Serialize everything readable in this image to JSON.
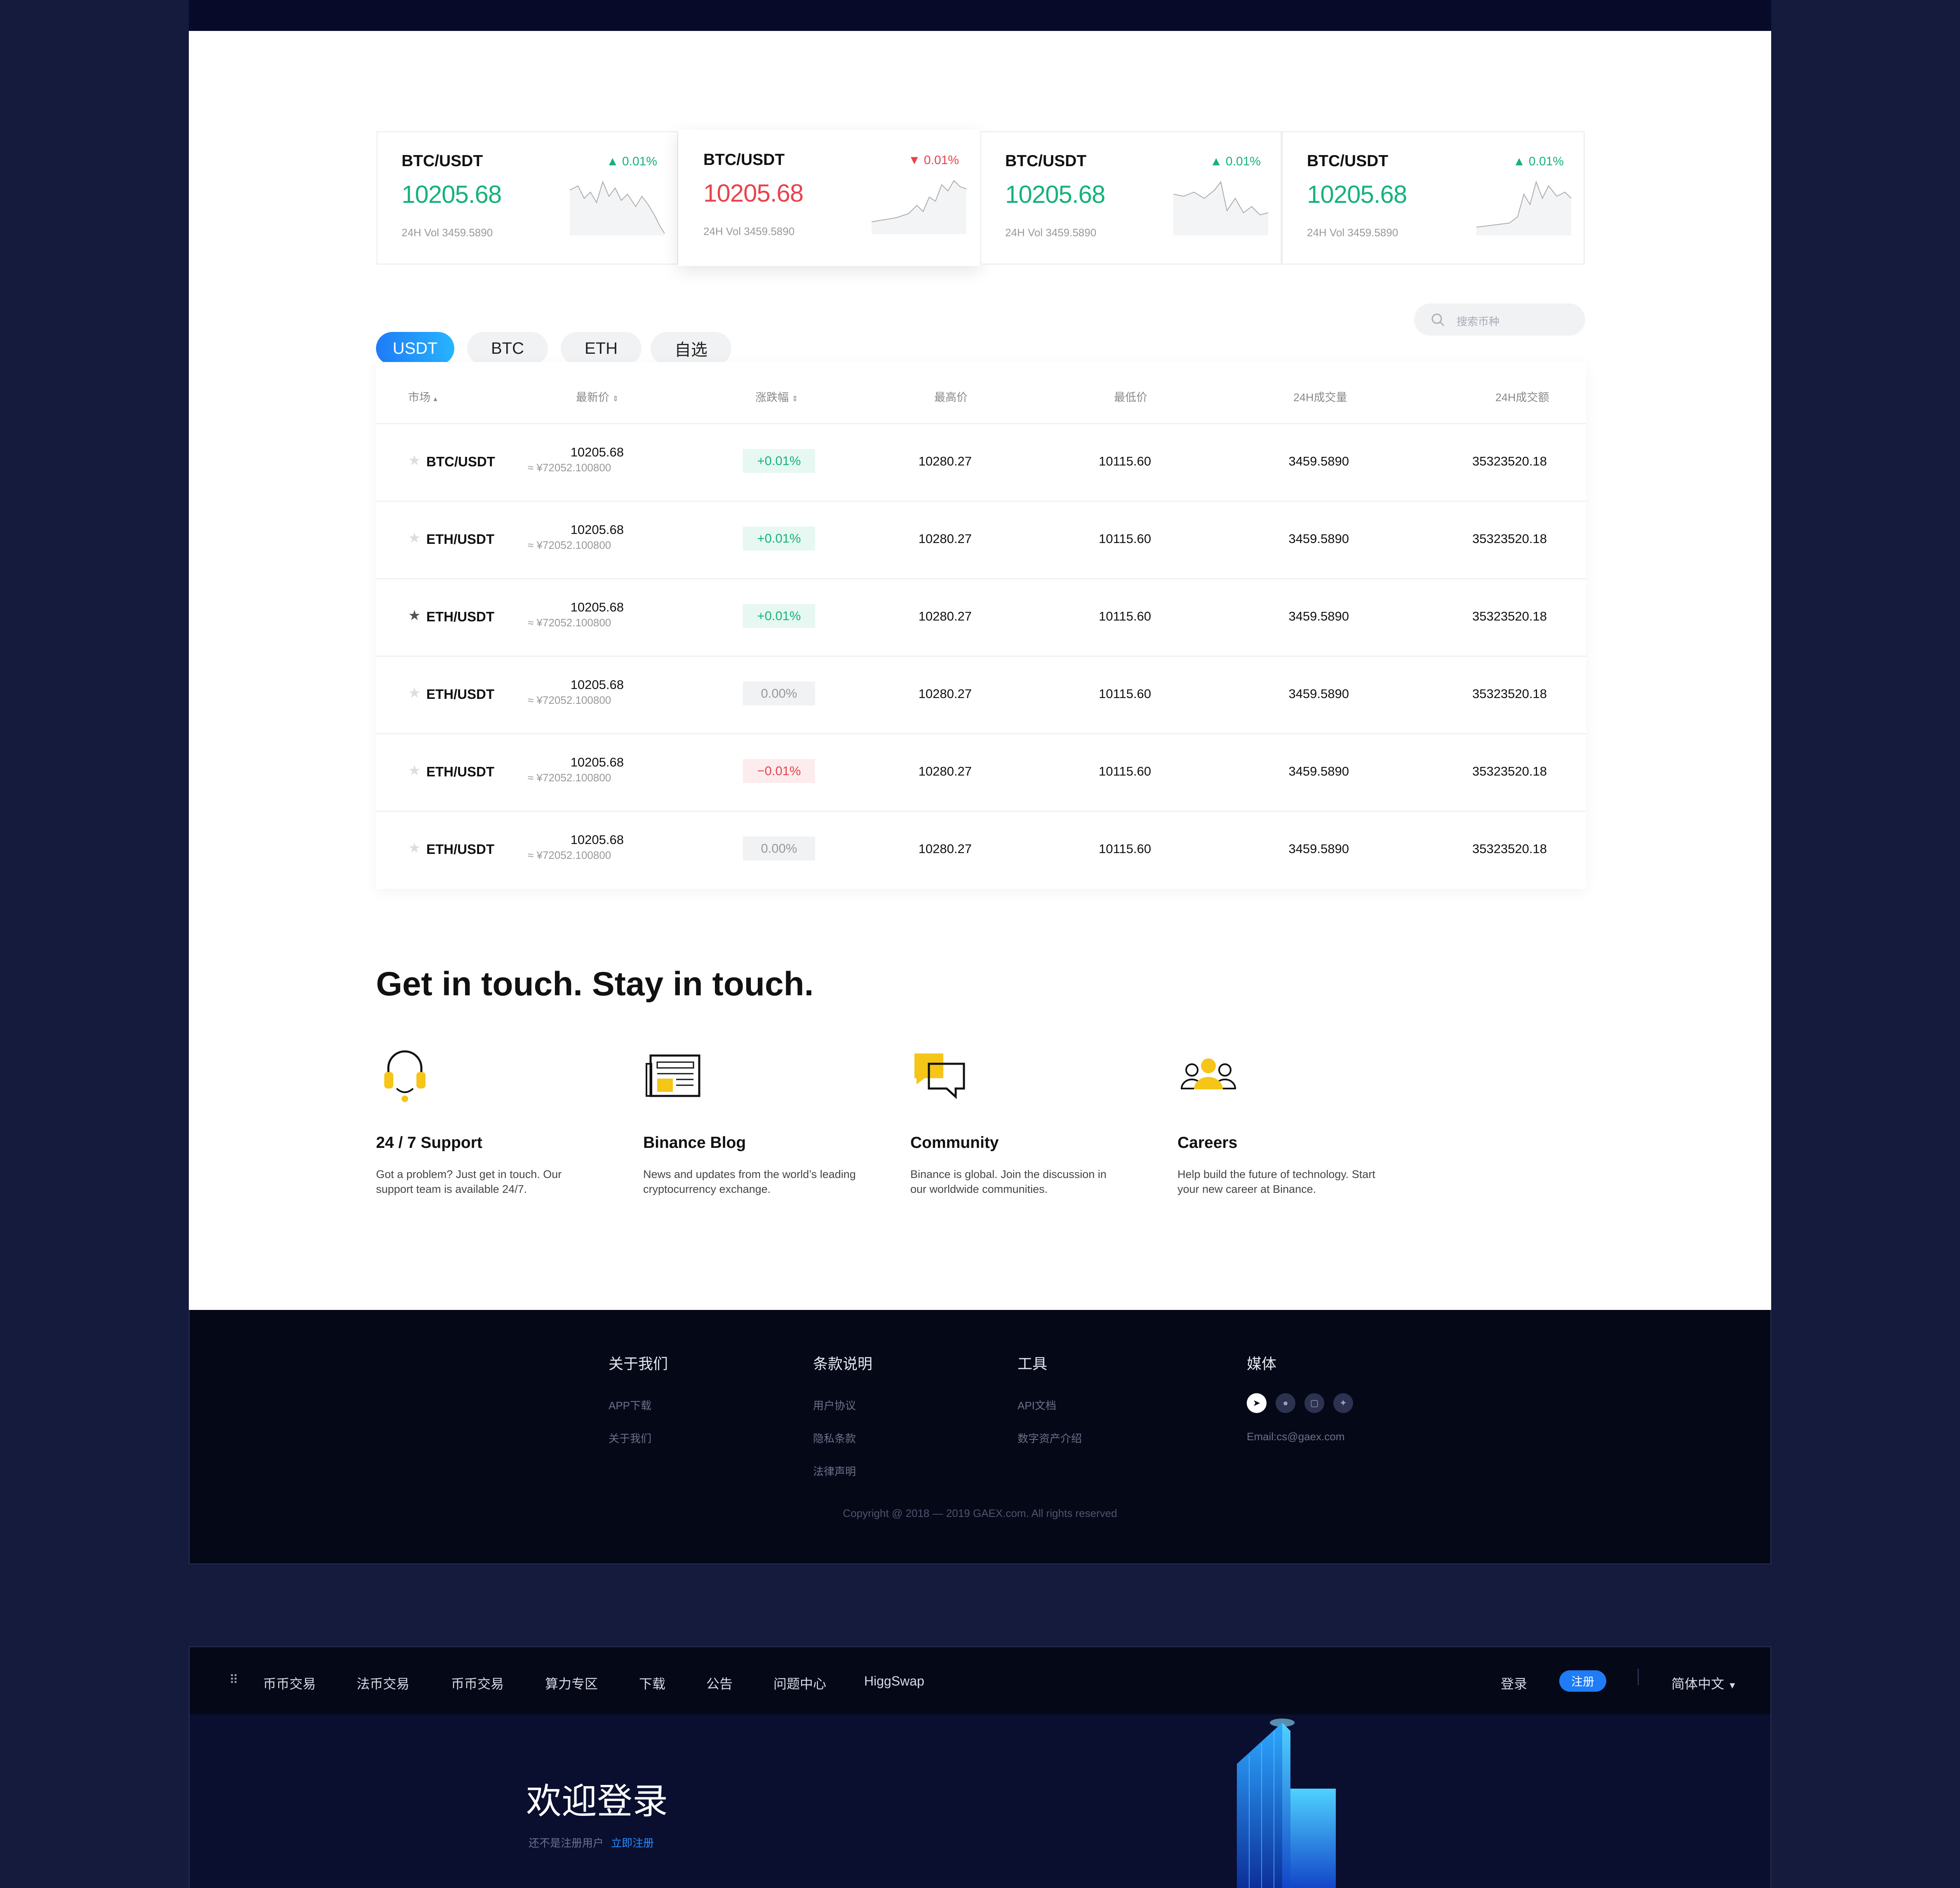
{
  "tickers": [
    {
      "pair": "BTC/USDT",
      "price": "10205.68",
      "vol": "24H Vol 3459.5890",
      "change": "0.01%",
      "dir": "up"
    },
    {
      "pair": "BTC/USDT",
      "price": "10205.68",
      "vol": "24H Vol 3459.5890",
      "change": "0.01%",
      "dir": "down"
    },
    {
      "pair": "BTC/USDT",
      "price": "10205.68",
      "vol": "24H Vol 3459.5890",
      "change": "0.01%",
      "dir": "up"
    },
    {
      "pair": "BTC/USDT",
      "price": "10205.68",
      "vol": "24H Vol 3459.5890",
      "change": "0.01%",
      "dir": "up"
    }
  ],
  "tabs": [
    "USDT",
    "BTC",
    "ETH",
    "自选"
  ],
  "search": {
    "placeholder": "搜索币种"
  },
  "table": {
    "headers": [
      "市场",
      "最新价",
      "涨跌幅",
      "最高价",
      "最低价",
      "24H成交量",
      "24H成交额"
    ],
    "rows": [
      {
        "pair": "BTC/USDT",
        "last": "10205.68",
        "cny": "≈ ¥72052.100800",
        "change": "+0.01%",
        "dir": "up",
        "high": "10280.27",
        "low": "10115.60",
        "vol": "3459.5890",
        "amount": "35323520.18",
        "starred": false
      },
      {
        "pair": "ETH/USDT",
        "last": "10205.68",
        "cny": "≈ ¥72052.100800",
        "change": "+0.01%",
        "dir": "up",
        "high": "10280.27",
        "low": "10115.60",
        "vol": "3459.5890",
        "amount": "35323520.18",
        "starred": false
      },
      {
        "pair": "ETH/USDT",
        "last": "10205.68",
        "cny": "≈ ¥72052.100800",
        "change": "+0.01%",
        "dir": "up",
        "high": "10280.27",
        "low": "10115.60",
        "vol": "3459.5890",
        "amount": "35323520.18",
        "starred": true
      },
      {
        "pair": "ETH/USDT",
        "last": "10205.68",
        "cny": "≈ ¥72052.100800",
        "change": "0.00%",
        "dir": "flat",
        "high": "10280.27",
        "low": "10115.60",
        "vol": "3459.5890",
        "amount": "35323520.18",
        "starred": false
      },
      {
        "pair": "ETH/USDT",
        "last": "10205.68",
        "cny": "≈ ¥72052.100800",
        "change": "−0.01%",
        "dir": "down",
        "high": "10280.27",
        "low": "10115.60",
        "vol": "3459.5890",
        "amount": "35323520.18",
        "starred": false
      },
      {
        "pair": "ETH/USDT",
        "last": "10205.68",
        "cny": "≈ ¥72052.100800",
        "change": "0.00%",
        "dir": "flat",
        "high": "10280.27",
        "low": "10115.60",
        "vol": "3459.5890",
        "amount": "35323520.18",
        "starred": false
      }
    ]
  },
  "contact": {
    "heading": "Get in touch. Stay in touch.",
    "features": [
      {
        "icon": "headset-icon",
        "title": "24 / 7 Support",
        "desc": "Got a problem? Just get in touch. Our support team is available 24/7."
      },
      {
        "icon": "newspaper-icon",
        "title": "Binance Blog",
        "desc": "News and updates from the world’s leading cryptocurrency exchange."
      },
      {
        "icon": "chat-bubbles-icon",
        "title": "Community",
        "desc": "Binance is global. Join the discussion in our worldwide communities."
      },
      {
        "icon": "people-icon",
        "title": "Careers",
        "desc": "Help build the future of technology. Start your new career at Binance."
      }
    ]
  },
  "footer": {
    "cols": [
      {
        "title": "关于我们",
        "links": [
          "APP下载",
          "关于我们"
        ]
      },
      {
        "title": "条款说明",
        "links": [
          "用户协议",
          "隐私条款",
          "法律声明"
        ]
      },
      {
        "title": "工具",
        "links": [
          "API文档",
          "数字资产介绍"
        ]
      },
      {
        "title": "媒体",
        "links": [
          "Email:cs@gaex.com"
        ]
      }
    ],
    "social": [
      "telegram-icon",
      "wechat-icon",
      "square-icon",
      "twitter-icon"
    ],
    "copyright": "Copyright @ 2018 — 2019 GAEX.com. All rights reserved"
  },
  "nav": {
    "items": [
      "币币交易",
      "法币交易",
      "币币交易",
      "算力专区",
      "下载",
      "公告",
      "问题中心",
      "HiggSwap"
    ],
    "login": "登录",
    "register": "注册",
    "language": "简体中文"
  },
  "hero": {
    "title": "欢迎登录",
    "not_registered": "还不是注册用户",
    "register_now": "立即注册"
  },
  "colors": {
    "up": "#16b27a",
    "down": "#e8434e",
    "accent": "#1e7cf7",
    "bg": "#151b3d"
  }
}
